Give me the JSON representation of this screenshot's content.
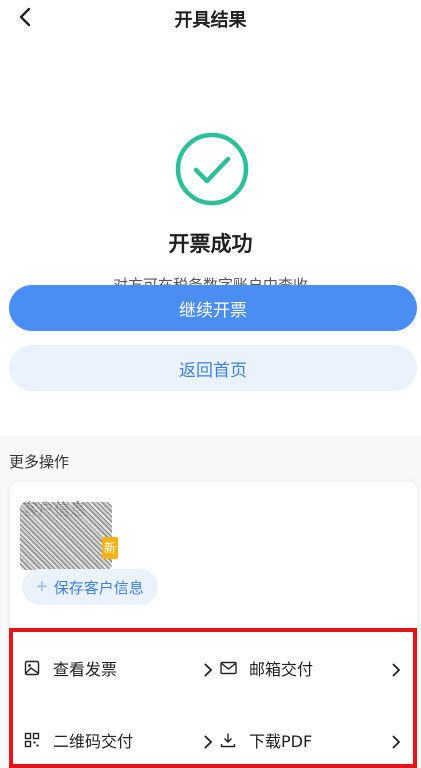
{
  "header": {
    "title": "开具结果"
  },
  "result": {
    "title": "开票成功",
    "subtitle": "对方可在税务数字账户中查收",
    "primary_button": "继续开票",
    "secondary_button": "返回首页"
  },
  "more": {
    "section_title": "更多操作",
    "customer_card": {
      "title": "客户信息",
      "tag": "新",
      "save_button": "保存客户信息"
    },
    "actions": [
      {
        "label": "查看发票",
        "icon": "image-icon"
      },
      {
        "label": "邮箱交付",
        "icon": "mail-icon"
      },
      {
        "label": "二维码交付",
        "icon": "qrcode-icon"
      },
      {
        "label": "下载PDF",
        "icon": "download-icon"
      }
    ]
  },
  "colors": {
    "primary": "#4b8ef3",
    "success": "#2dbf9a",
    "highlight": "#e8141b"
  }
}
